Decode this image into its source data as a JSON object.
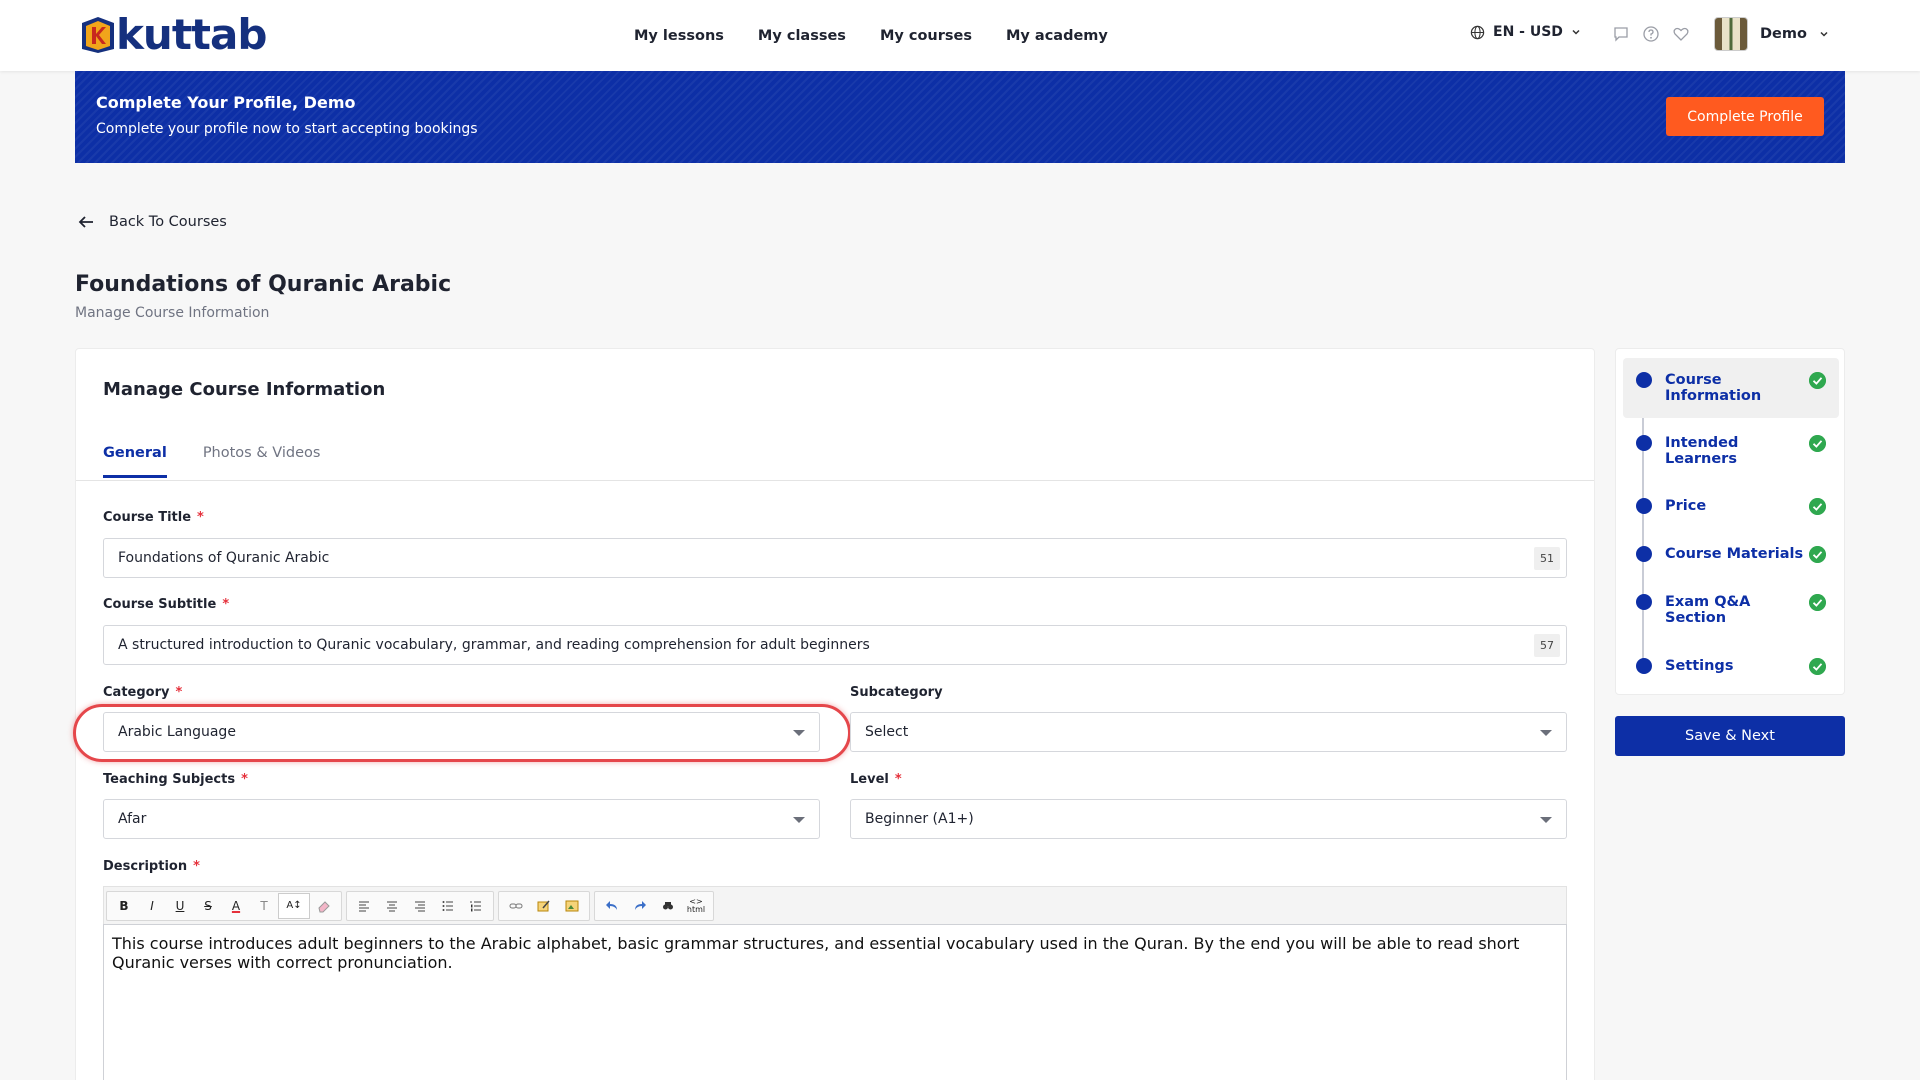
{
  "header": {
    "logo_text": "kuttab",
    "nav": [
      "My lessons",
      "My classes",
      "My courses",
      "My academy"
    ],
    "lang_currency": "EN - USD",
    "user_name": "Demo"
  },
  "banner": {
    "title": "Complete Your Profile, Demo",
    "subtitle": "Complete your profile now to start accepting bookings",
    "button": "Complete Profile"
  },
  "back_link": "Back To Courses",
  "page": {
    "title": "Foundations of Quranic Arabic",
    "subtitle": "Manage Course Information"
  },
  "card": {
    "title": "Manage Course Information",
    "tabs": [
      "General",
      "Photos & Videos"
    ],
    "active_tab": "General"
  },
  "form": {
    "course_title_label": "Course Title",
    "course_title_value": "Foundations of Quranic Arabic",
    "course_title_count": "51",
    "course_subtitle_label": "Course Subtitle",
    "course_subtitle_value": "A structured introduction to Quranic vocabulary, grammar, and reading comprehension for adult beginners",
    "course_subtitle_count": "57",
    "category_label": "Category",
    "category_value": "Arabic Language",
    "subcategory_label": "Subcategory",
    "subcategory_value": "Select",
    "teaching_subjects_label": "Teaching Subjects",
    "teaching_subjects_value": "Afar",
    "level_label": "Level",
    "level_value": "Beginner (A1+)",
    "description_label": "Description",
    "description_value": "This course introduces adult beginners to the Arabic alphabet, basic grammar structures, and essential vocabulary used in the Quran. By the end you will be able to read short Quranic verses with correct pronunciation.",
    "required_mark": "*"
  },
  "toolbar": {
    "bold": "B",
    "italic": "I",
    "underline": "U",
    "strike": "S",
    "font_color": "A",
    "clear_format": "T",
    "font_size": "A↕",
    "html": "html"
  },
  "steps": [
    {
      "label": "Course Information"
    },
    {
      "label": "Intended Learners"
    },
    {
      "label": "Price"
    },
    {
      "label": "Course Materials"
    },
    {
      "label": "Exam Q&A Section"
    },
    {
      "label": "Settings"
    }
  ],
  "save_button": "Save & Next",
  "colors": {
    "brand": "#0d2fa6",
    "accent": "#ff5a1f",
    "success": "#2fa84f",
    "required": "#e5303b"
  }
}
